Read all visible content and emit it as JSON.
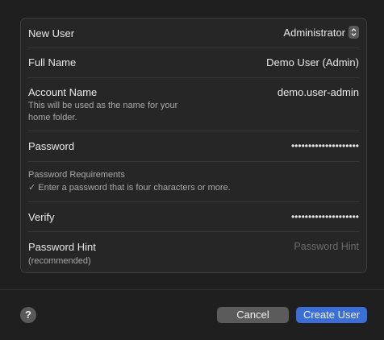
{
  "form": {
    "new_user": {
      "label": "New User",
      "value": "Administrator"
    },
    "full_name": {
      "label": "Full Name",
      "value": "Demo User (Admin)"
    },
    "account_name": {
      "label": "Account Name",
      "value": "demo.user-admin",
      "help_line1": "This will be used as the name for your",
      "help_line2": "home folder."
    },
    "password": {
      "label": "Password",
      "value": "••••••••••••••••••••"
    },
    "requirements": {
      "title": "Password Requirements",
      "item": "✓ Enter a password that is four characters or more."
    },
    "verify": {
      "label": "Verify",
      "value": "••••••••••••••••••••"
    },
    "hint": {
      "label": "Password Hint",
      "sub": "(recommended)",
      "placeholder": "Password Hint"
    }
  },
  "footer": {
    "help_label": "?",
    "cancel_label": "Cancel",
    "create_label": "Create User"
  },
  "colors": {
    "accent": "#3b6fd6",
    "background": "#1f1f1f"
  }
}
